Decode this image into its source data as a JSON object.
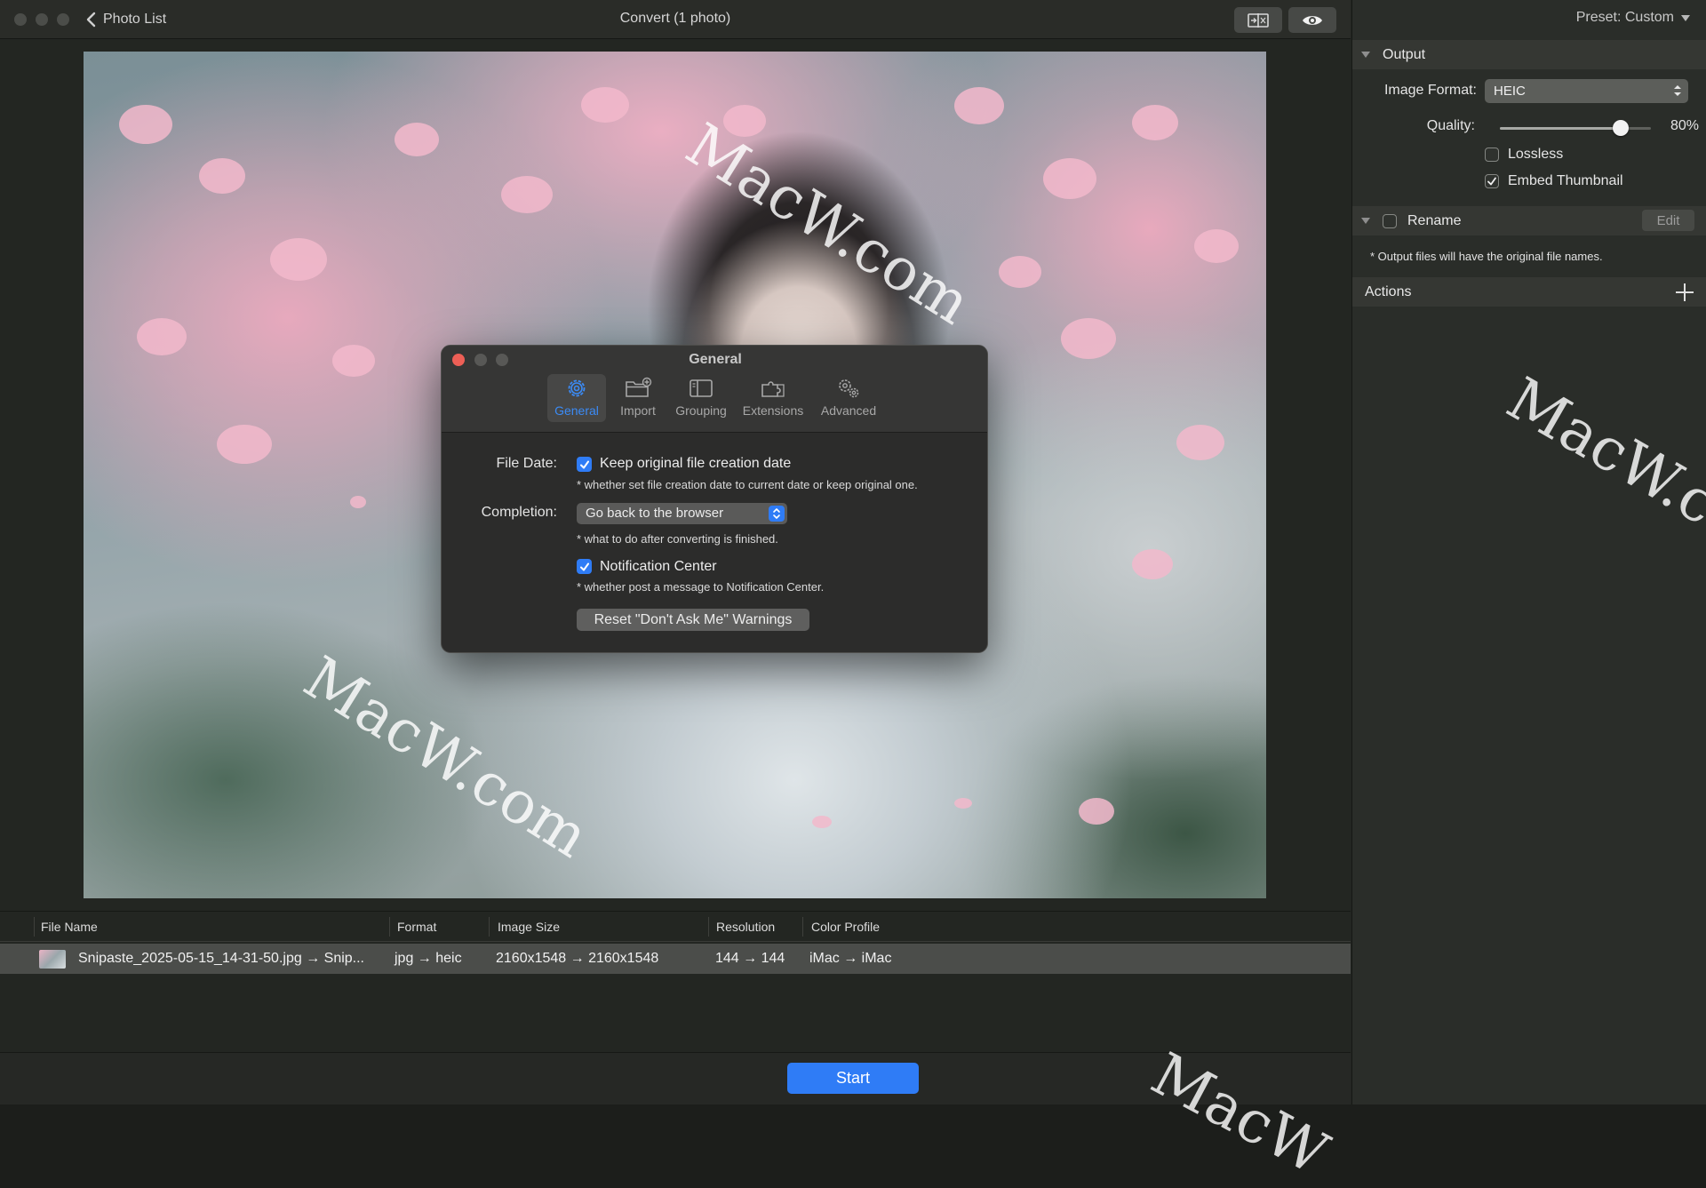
{
  "titlebar": {
    "back_label": "Photo List",
    "title": "Convert (1 photo)"
  },
  "photo": {
    "description_icon": "anime-portrait-cherry-blossoms-image"
  },
  "file_list": {
    "columns": [
      "File Name",
      "Format",
      "Image Size",
      "Resolution",
      "Color Profile"
    ],
    "rows": [
      {
        "file_name": "Snipaste_2025-05-15_14-31-50.jpg → Snip...",
        "format": "jpg → heic",
        "image_size": "2160x1548 → 2160x1548",
        "resolution": "144 → 144",
        "color_profile": "iMac → iMac"
      }
    ]
  },
  "bottom": {
    "start_label": "Start",
    "accent": "#2f7cf6"
  },
  "sidebar": {
    "preset_label": "Preset: Custom",
    "output": {
      "header": "Output",
      "image_format_label": "Image Format:",
      "image_format_value": "HEIC",
      "quality_label": "Quality:",
      "quality_value": "80%",
      "quality_fraction": 0.8,
      "lossless_label": "Lossless",
      "lossless_checked": false,
      "embed_thumbnail_label": "Embed Thumbnail",
      "embed_thumbnail_checked": true
    },
    "rename": {
      "header": "Rename",
      "edit_label": "Edit",
      "note": "* Output files will have the original file names."
    },
    "actions": {
      "header": "Actions"
    }
  },
  "dialog": {
    "title": "General",
    "tabs": [
      {
        "label": "General",
        "icon": "gear-icon",
        "active": true
      },
      {
        "label": "Import",
        "icon": "folder-plus-icon",
        "active": false
      },
      {
        "label": "Grouping",
        "icon": "sidebar-panel-icon",
        "active": false
      },
      {
        "label": "Extensions",
        "icon": "puzzle-icon",
        "active": false
      },
      {
        "label": "Advanced",
        "icon": "gears-icon",
        "active": false
      }
    ],
    "file_date_label": "File Date:",
    "file_date_option": "Keep original file creation date",
    "file_date_note": "* whether set file creation date to current date or keep original one.",
    "completion_label": "Completion:",
    "completion_value": "Go back to the browser",
    "completion_note": "* what to do after converting is finished.",
    "notification_label": "Notification Center",
    "notification_note": "* whether post a message to Notification Center.",
    "reset_button": "Reset \"Don't Ask Me\" Warnings"
  },
  "watermark": {
    "text_upper": "MacW.com",
    "text_lower": "MacW.com",
    "text_right": "MacW.c",
    "text_bottom": "MacW"
  }
}
